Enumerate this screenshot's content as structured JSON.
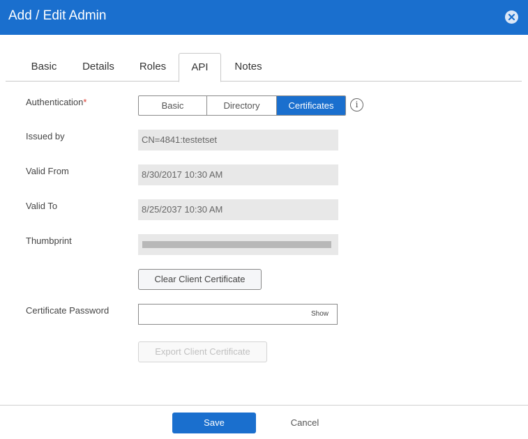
{
  "dialog": {
    "title": "Add / Edit Admin",
    "close_icon": "close-circle-icon"
  },
  "tabs": [
    {
      "label": "Basic",
      "active": false
    },
    {
      "label": "Details",
      "active": false
    },
    {
      "label": "Roles",
      "active": false
    },
    {
      "label": "API",
      "active": true
    },
    {
      "label": "Notes",
      "active": false
    }
  ],
  "form": {
    "authentication": {
      "label": "Authentication",
      "required_marker": "*",
      "options": [
        "Basic",
        "Directory",
        "Certificates"
      ],
      "selected": "Certificates",
      "info_icon": "info-icon",
      "info_glyph": "i"
    },
    "issued_by": {
      "label": "Issued by",
      "value": "CN=4841:testetset"
    },
    "valid_from": {
      "label": "Valid From",
      "value": "8/30/2017 10:30 AM"
    },
    "valid_to": {
      "label": "Valid To",
      "value": "8/25/2037 10:30 AM"
    },
    "thumbprint": {
      "label": "Thumbprint"
    },
    "clear_button": "Clear Client Certificate",
    "certificate_password": {
      "label": "Certificate Password",
      "value": "",
      "show_label": "Show"
    },
    "export_button": "Export Client Certificate"
  },
  "footer": {
    "save_label": "Save",
    "cancel_label": "Cancel"
  },
  "colors": {
    "accent": "#1a6fce",
    "required": "#d9372b",
    "readonly_bg": "#e8e8e8"
  }
}
